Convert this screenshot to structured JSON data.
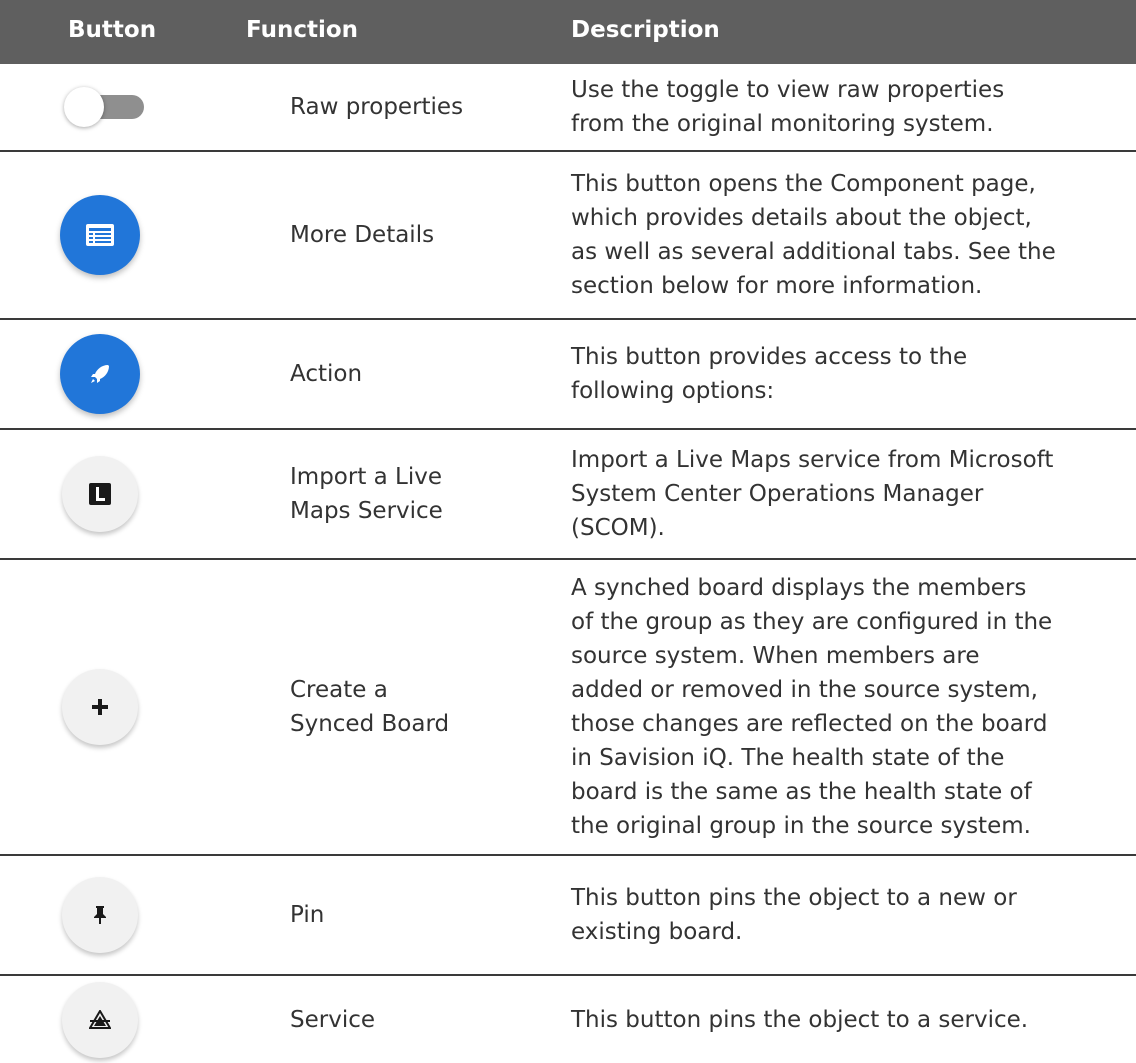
{
  "header": {
    "button": "Button",
    "function": "Function",
    "description": "Description"
  },
  "rows": [
    {
      "icon": "toggle-icon",
      "function": "Raw properties",
      "description": "Use the toggle to view raw properties\nfrom the original monitoring system."
    },
    {
      "icon": "list-details-icon",
      "function": "More Details",
      "description": "This button opens the Component page,\nwhich provides details about the object,\nas well as several additional tabs. See the\nsection below for more information."
    },
    {
      "icon": "rocket-icon",
      "function": "Action",
      "description": "This button provides access to the\nfollowing options:"
    },
    {
      "icon": "live-maps-l-icon",
      "function": "Import a Live\nMaps Service",
      "description": "Import a Live Maps service from Microsoft\nSystem Center Operations Manager\n(SCOM)."
    },
    {
      "icon": "plus-icon",
      "function": "Create a\nSynced Board",
      "description": "A synched board displays the members\nof the group as they are configured in the\nsource system. When members are\nadded or removed in the source system,\nthose changes are reflected on the board\nin Savision iQ. The health state of the\nboard is the same as the health state of\nthe original group in the source system."
    },
    {
      "icon": "pin-icon",
      "function": "Pin",
      "description": "This button pins the object to a new or\nexisting board."
    },
    {
      "icon": "service-icon",
      "function": "Service",
      "description": "This button pins the object to a service."
    }
  ],
  "colors": {
    "header_bg": "#5f5f5f",
    "accent_blue": "#2176d9",
    "light_button": "#f1f1f1"
  }
}
